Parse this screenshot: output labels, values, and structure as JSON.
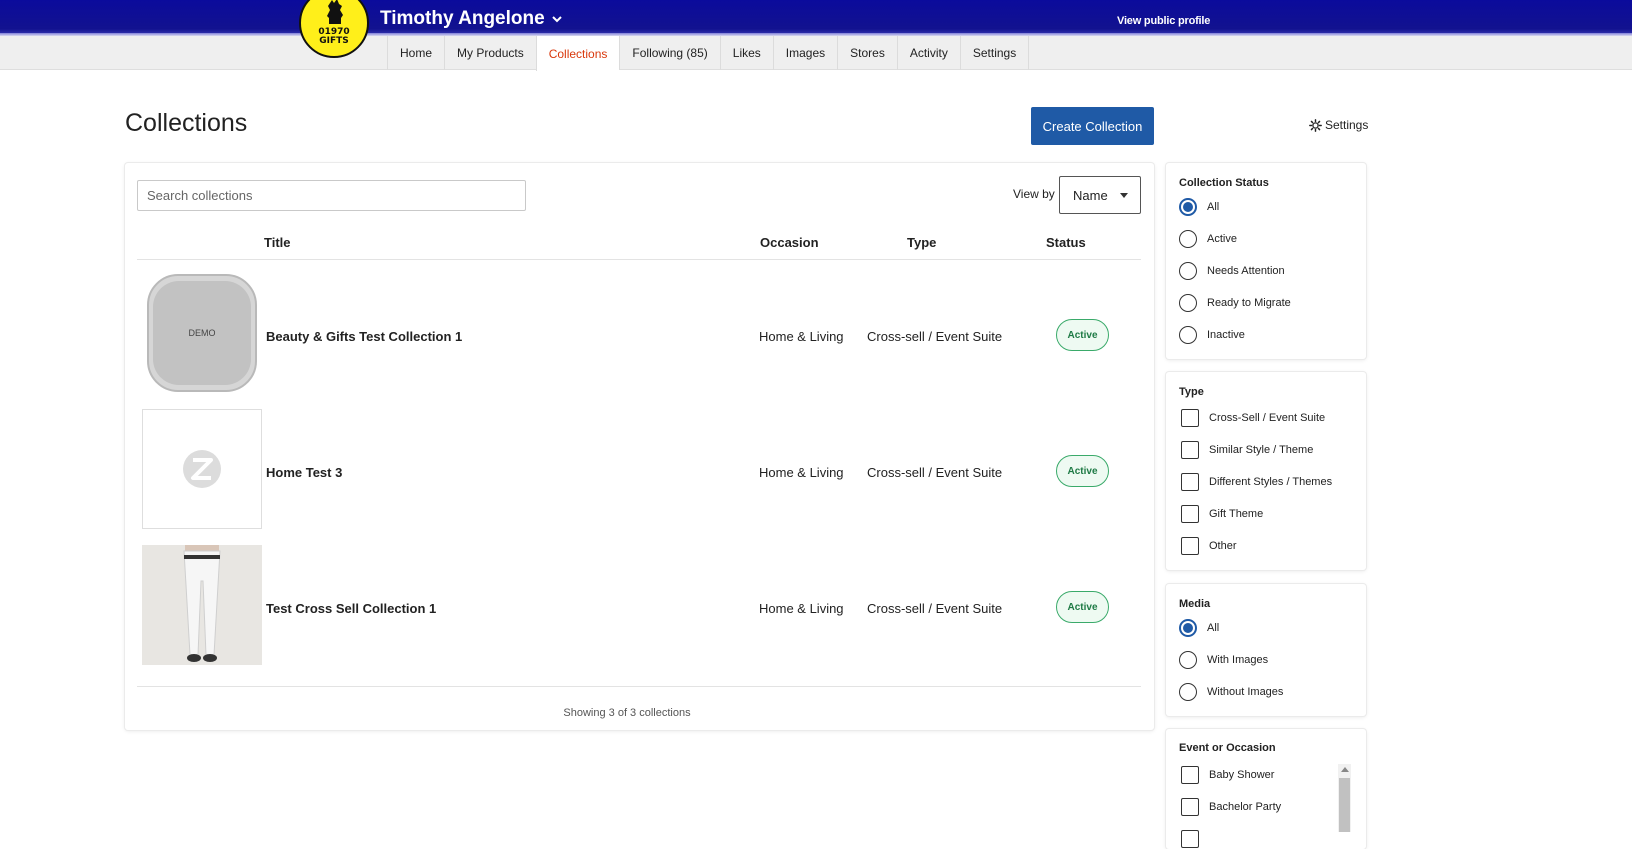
{
  "header": {
    "user_name": "Timothy Angelone",
    "view_public_profile": "View public profile",
    "logo_text_line1": "01970",
    "logo_text_line2": "GIFTS",
    "colors": {
      "bar": "#0b0b9c",
      "logo_bg": "#ffef1a"
    }
  },
  "nav": {
    "tabs": [
      {
        "label": "Home"
      },
      {
        "label": "My Products"
      },
      {
        "label": "Collections",
        "active": true
      },
      {
        "label": "Following (85)"
      },
      {
        "label": "Likes"
      },
      {
        "label": "Images"
      },
      {
        "label": "Stores"
      },
      {
        "label": "Activity"
      },
      {
        "label": "Settings"
      }
    ],
    "active_color": "#d9380c"
  },
  "page": {
    "title": "Collections",
    "create_button": "Create Collection",
    "settings_label": "Settings",
    "accent": "#1f5aa6"
  },
  "toolbar": {
    "search_placeholder": "Search collections",
    "view_by_label": "View by",
    "view_by_value": "Name"
  },
  "table": {
    "headers": {
      "title": "Title",
      "occasion": "Occasion",
      "type": "Type",
      "status": "Status"
    },
    "rows": [
      {
        "title": "Beauty & Gifts Test Collection 1",
        "occasion": "Home & Living",
        "type": "Cross-sell / Event Suite",
        "status": "Active",
        "thumb": "compact-mirror-image",
        "thumb_label": "DEMO"
      },
      {
        "title": "Home Test 3",
        "occasion": "Home & Living",
        "type": "Cross-sell / Event Suite",
        "status": "Active",
        "thumb": "placeholder-logo-image"
      },
      {
        "title": "Test Cross Sell Collection 1",
        "occasion": "Home & Living",
        "type": "Cross-sell / Event Suite",
        "status": "Active",
        "thumb": "leggings-image"
      }
    ],
    "footer": "Showing 3 of 3 collections"
  },
  "filters": {
    "status": {
      "title": "Collection Status",
      "options": [
        {
          "label": "All",
          "checked": true
        },
        {
          "label": "Active",
          "checked": false
        },
        {
          "label": "Needs Attention",
          "checked": false
        },
        {
          "label": "Ready to Migrate",
          "checked": false
        },
        {
          "label": "Inactive",
          "checked": false
        }
      ]
    },
    "type": {
      "title": "Type",
      "options": [
        {
          "label": "Cross-Sell / Event Suite"
        },
        {
          "label": "Similar Style / Theme"
        },
        {
          "label": "Different Styles / Themes"
        },
        {
          "label": "Gift Theme"
        },
        {
          "label": "Other"
        }
      ]
    },
    "media": {
      "title": "Media",
      "options": [
        {
          "label": "All",
          "checked": true
        },
        {
          "label": "With Images",
          "checked": false
        },
        {
          "label": "Without Images",
          "checked": false
        }
      ]
    },
    "occasion": {
      "title": "Event or Occasion",
      "options": [
        {
          "label": "Baby Shower"
        },
        {
          "label": "Bachelor Party"
        }
      ]
    }
  }
}
